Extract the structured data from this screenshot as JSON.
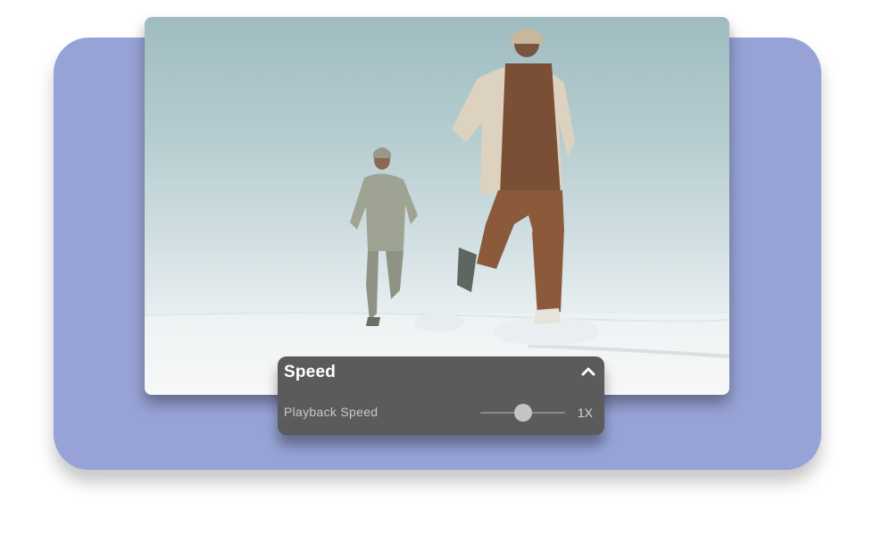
{
  "speed_panel": {
    "title": "Speed",
    "collapse_icon": "chevron-up-icon",
    "playback_label": "Playback Speed",
    "speed_value": "1X",
    "slider_position": 0.5
  },
  "colors": {
    "backdrop": "#97a3d6",
    "panel_background": "#5b5b5b"
  }
}
